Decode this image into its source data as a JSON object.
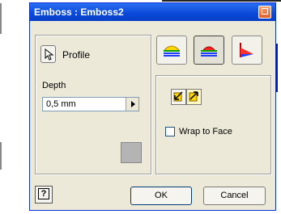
{
  "window": {
    "title": "Emboss : Emboss2"
  },
  "profile": {
    "label": "Profile"
  },
  "depth": {
    "label": "Depth",
    "value": "0,5 mm"
  },
  "wrap": {
    "label": "Wrap to Face",
    "checked": false
  },
  "buttons": {
    "ok": "OK",
    "cancel": "Cancel",
    "help": "?"
  },
  "icons": {
    "title_help": "help-icon",
    "profile": "cursor-arrow-icon",
    "emboss_from_face": "emboss-from-face-icon",
    "engrave_from_face": "engrave-from-face-icon",
    "emboss_engrave_from_plane": "emboss-engrave-from-plane-icon",
    "direction_1": "direction-1-icon",
    "direction_2": "direction-2-icon"
  },
  "colors": {
    "title_bar": "#0a48d8",
    "dialog_bg": "#ece9d8",
    "swatch": "#b4b4b4"
  }
}
